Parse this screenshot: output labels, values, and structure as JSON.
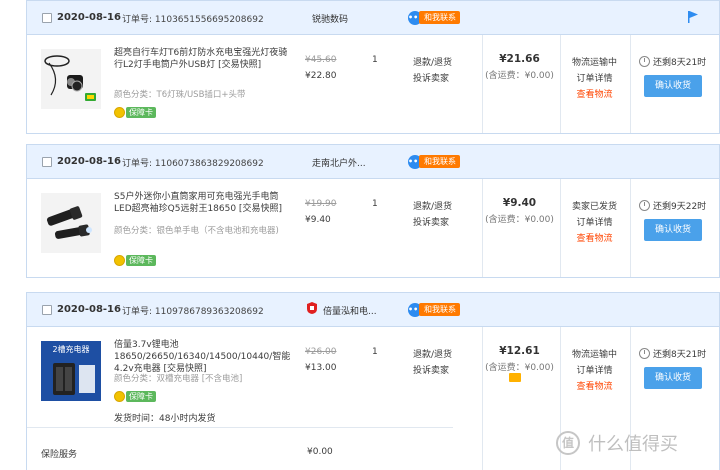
{
  "orders": [
    {
      "date": "2020-08-16",
      "order_no": "订单号: 1103651556695208692",
      "shop": "锐驰数码",
      "contact_label": "和我联系",
      "title": "超亮自行车灯T6前灯防水充电宝强光灯夜骑行L2灯手电筒户外USB灯 [交易快照]",
      "sku": "颜色分类：T6灯珠/USB插口+头带",
      "badge": "保障卡",
      "orig_price": "¥45.60",
      "price": "¥22.80",
      "qty": "1",
      "after_sale": [
        "退款/退货",
        "投诉卖家"
      ],
      "total": "¥21.66",
      "shipping": "(含运费：¥0.00)",
      "status": [
        "物流运输中",
        "订单详情",
        "查看物流"
      ],
      "remaining": "还剩8天21时",
      "confirm": "确认收货"
    },
    {
      "date": "2020-08-16",
      "order_no": "订单号: 1106073863829208692",
      "shop": "走南北户外...",
      "contact_label": "和我联系",
      "title": "S5户外迷你小直筒家用可充电强光手电筒LED超亮袖珍Q5远射王18650 [交易快照]",
      "sku": "颜色分类：银色单手电（不含电池和充电器)",
      "badge": "保障卡",
      "orig_price": "¥19.90",
      "price": "¥9.40",
      "qty": "1",
      "after_sale": [
        "退款/退货",
        "投诉卖家"
      ],
      "total": "¥9.40",
      "shipping": "(含运费：¥0.00)",
      "status": [
        "卖家已发货",
        "订单详情",
        "查看物流"
      ],
      "remaining": "还剩9天22时",
      "confirm": "确认收货"
    },
    {
      "date": "2020-08-16",
      "order_no": "订单号: 1109786789363208692",
      "shop": "倍量泓和电...",
      "contact_label": "和我联系",
      "title": "倍量3.7v锂电池18650/26650/16340/14500/10440/智能4.2v充电器 [交易快照]",
      "sku": "颜色分类：双槽充电器 [不含电池]",
      "badge": "保障卡",
      "ship_time": "发货时间：48小时内发货",
      "orig_price": "¥26.00",
      "price": "¥13.00",
      "qty": "1",
      "after_sale": [
        "退款/退货",
        "投诉卖家"
      ],
      "total": "¥12.61",
      "shipping": "(含运费：¥0.00)",
      "status": [
        "物流运输中",
        "订单详情",
        "查看物流"
      ],
      "remaining": "还剩8天21时",
      "confirm": "确认收货",
      "service_label": "保险服务",
      "service_price": "¥0.00",
      "thumb_text": "2槽充电器"
    }
  ],
  "watermark": {
    "icon": "值",
    "text": "什么值得买"
  },
  "colors": {
    "accent": "#4aa1ea",
    "header_bg": "#e8f2ff",
    "orange": "#ff4400"
  }
}
